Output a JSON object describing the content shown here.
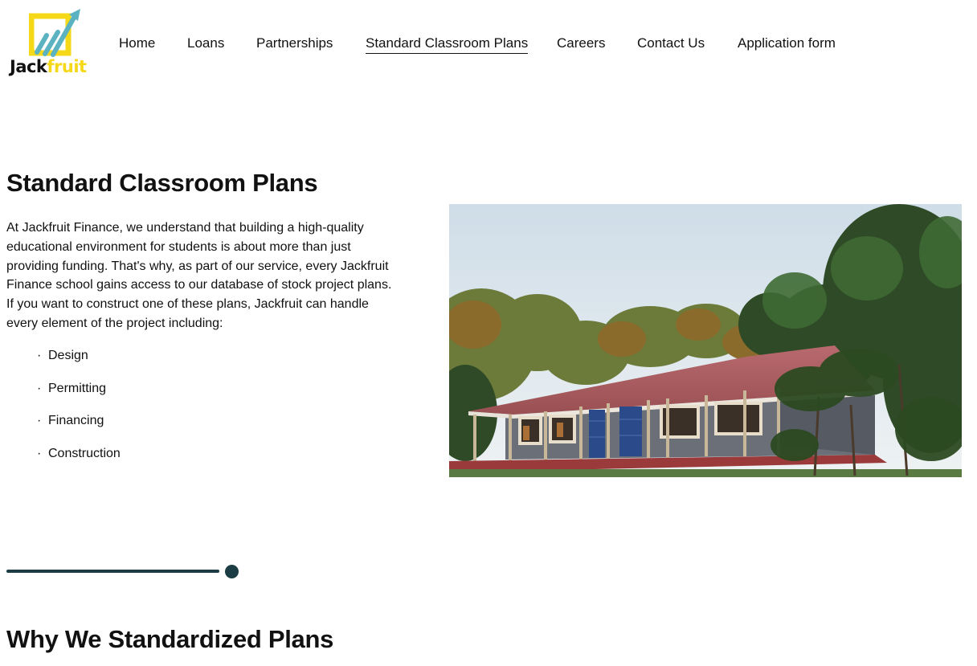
{
  "brand": {
    "name_part1": "Jack",
    "name_part2": "fruit",
    "logo_icon": "chart-arrow-icon",
    "accent_yellow": "#f5d817",
    "accent_teal": "#5bb3c1"
  },
  "nav": {
    "items": [
      {
        "label": "Home"
      },
      {
        "label": "Loans"
      },
      {
        "label": "Partnerships"
      },
      {
        "label": "Standard Classroom Plans",
        "active": true
      },
      {
        "label": "Careers"
      },
      {
        "label": "Contact Us"
      },
      {
        "label": "Application form"
      }
    ]
  },
  "main": {
    "title": "Standard Classroom Plans",
    "intro": "At Jackfruit Finance, we understand that building a high-quality educational environment for students is about more than just providing funding. That's why, as part of our service, every Jackfruit Finance school gains access to our database of stock project plans. If you want to construct one of these plans, Jackfruit can handle every element of the project including:",
    "services": [
      {
        "bullet": "·",
        "label": "Design"
      },
      {
        "bullet": "·",
        "label": "Permitting"
      },
      {
        "bullet": "·",
        "label": "Financing"
      },
      {
        "bullet": "·",
        "label": "Construction"
      }
    ],
    "hero_image": "classroom-building-photo"
  },
  "slider": {
    "color": "#1c3c44"
  },
  "next_section": {
    "title": "Why We Standardized Plans"
  }
}
